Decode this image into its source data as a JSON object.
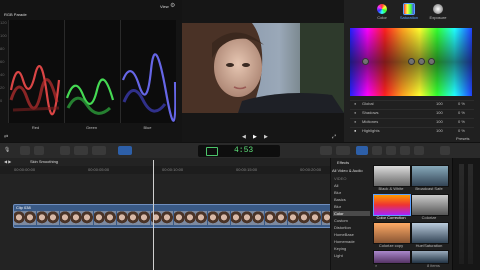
{
  "scopes": {
    "title": "RGB Parade",
    "view_menu": "View",
    "channels": [
      "Red",
      "Green",
      "Blue"
    ],
    "scale": [
      "120",
      "100",
      "80",
      "60",
      "40",
      "20",
      "0",
      "-20"
    ]
  },
  "inspector": {
    "tabs": [
      "Color",
      "Saturation",
      "Exposure"
    ],
    "rows": [
      {
        "label": "Global",
        "v1": "100",
        "v2": "0 %"
      },
      {
        "label": "Shadows",
        "v1": "100",
        "v2": "0 %"
      },
      {
        "label": "Midtones",
        "v1": "100",
        "v2": "0 %"
      },
      {
        "label": "Highlights",
        "v1": "100",
        "v2": "0 %"
      }
    ],
    "presets": "Presets"
  },
  "toolbar": {
    "timecode": "4:53"
  },
  "timeline": {
    "project": "Skin Smoothing",
    "ruler": [
      "00:00:00:00",
      "00:00:05:00",
      "00:00:10:00",
      "00:00:15:00",
      "00:00:20:00"
    ],
    "clip_name": "Clip 038"
  },
  "effects": {
    "title": "Effects",
    "categories": [
      "All Video & Audio",
      "VIDEO",
      "All",
      "Blur",
      "Basics",
      "Blur",
      "Color",
      "Custom",
      "Distortion",
      "HomeBase",
      "Homemade",
      "Keying",
      "Light"
    ],
    "selected_category": "Color",
    "items": [
      "Black & White",
      "Broadcast Safe",
      "Color Correction",
      "Colorize",
      "Colorize copy",
      "Hue/Saturation",
      "",
      ""
    ],
    "count": "8 items"
  },
  "colors": {
    "accent": "#5aa0ff",
    "clip": "#3a5a86",
    "selected": "#4a4a4a"
  }
}
